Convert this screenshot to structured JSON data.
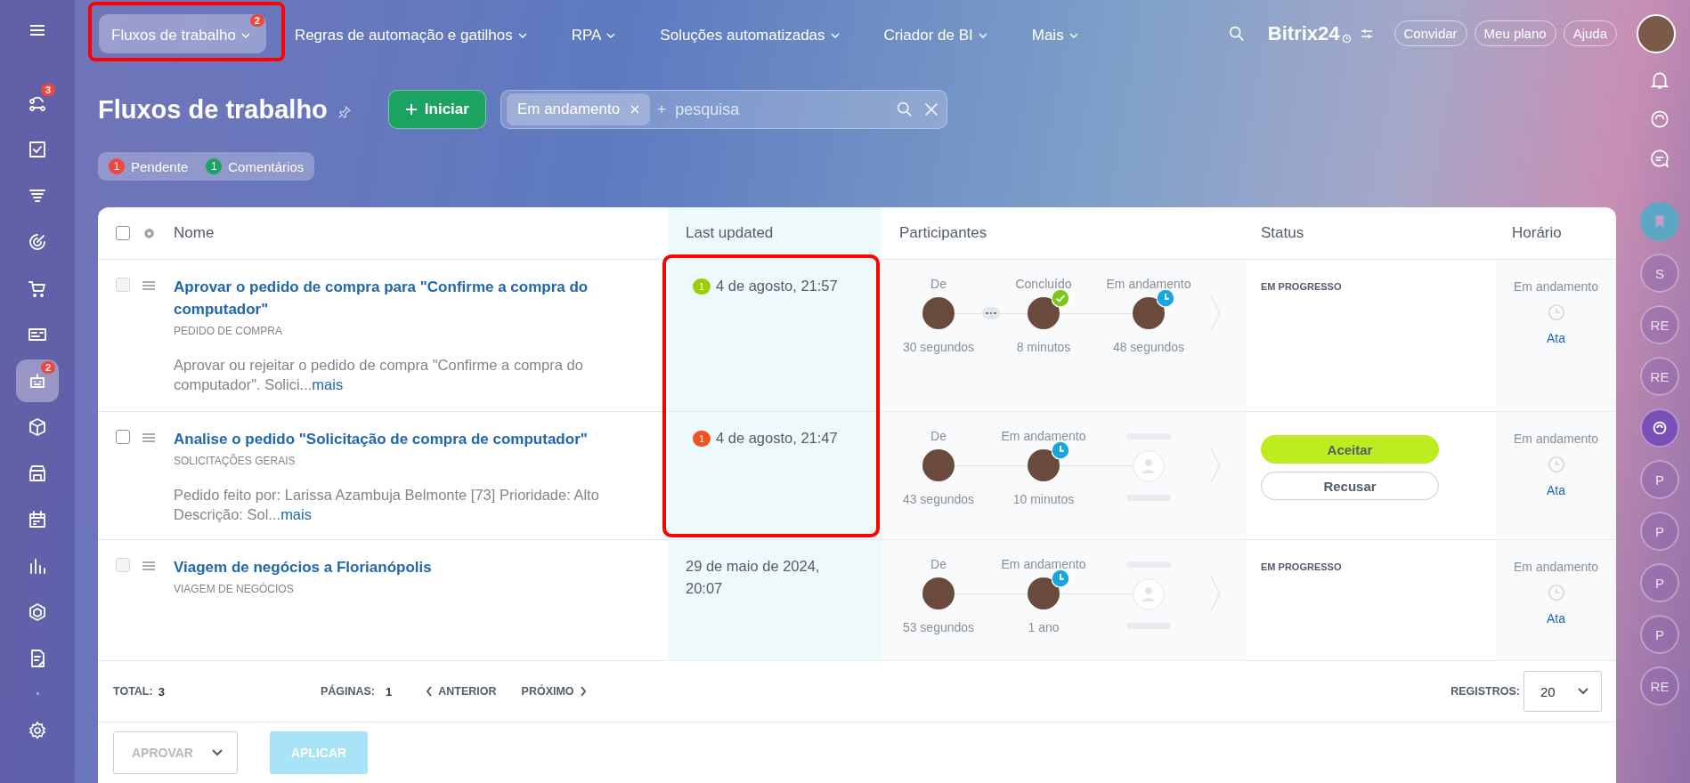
{
  "topbar": {
    "menu": [
      {
        "label": "Fluxos de trabalho",
        "selected": true,
        "badge": "2"
      },
      {
        "label": "Regras de automação e gatilhos",
        "selected": false
      },
      {
        "label": "RPA",
        "selected": false
      },
      {
        "label": "Soluções automatizadas",
        "selected": false
      },
      {
        "label": "Criador de BI",
        "selected": false
      },
      {
        "label": "Mais",
        "selected": false
      }
    ],
    "brand": "Bitrix24",
    "buttons": [
      "Convidar",
      "Meu plano",
      "Ajuda"
    ]
  },
  "sidebar": {
    "items": [
      {
        "selected": false,
        "badge": "3"
      },
      {
        "selected": false
      },
      {
        "selected": false
      },
      {
        "selected": false
      },
      {
        "selected": false
      },
      {
        "selected": false
      },
      {
        "selected": true,
        "badge": "2"
      },
      {
        "selected": false
      },
      {
        "selected": false
      },
      {
        "selected": false
      },
      {
        "selected": false
      },
      {
        "selected": false
      },
      {
        "selected": false
      }
    ]
  },
  "header": {
    "title": "Fluxos de trabalho",
    "start_button": "Iniciar",
    "search": {
      "chip": "Em andamento",
      "plus": "+",
      "placeholder": "pesquisa"
    },
    "counters": [
      {
        "count": "1",
        "label": "Pendente",
        "color": "#f2453d"
      },
      {
        "count": "1",
        "label": "Comentários",
        "color": "#1ca363"
      }
    ]
  },
  "table": {
    "select_all": {
      "checked": false
    },
    "columns": [
      "Nome",
      "Last updated",
      "Participantes",
      "Status",
      "Horário"
    ],
    "rows": [
      {
        "disabled": true,
        "title": "Aprovar o pedido de compra para \"Confirme a compra do computador\"",
        "category": "PEDIDO DE COMPRA",
        "description": "Aprovar ou rejeitar o pedido de compra \"Confirme a compra do computador\". Solici...",
        "more": "mais",
        "updated": {
          "badge": "1",
          "color": "#9dcf00",
          "text": "4 de agosto, 21:57"
        },
        "more_hidden": true,
        "stages": [
          {
            "kind": "person",
            "label": "De",
            "duration": "30 segundos",
            "done": false,
            "running": false
          },
          {
            "kind": "person",
            "label": "Concluído",
            "duration": "8 minutos",
            "done": true,
            "running": false
          },
          {
            "kind": "person",
            "label": "Em andamento",
            "duration": "48 segundos",
            "done": false,
            "running": true
          }
        ],
        "status": {
          "kind": "text",
          "text": "EM PROGRESSO"
        },
        "time": {
          "label": "Em andamento",
          "link": "Ata"
        }
      },
      {
        "disabled": false,
        "title": "Analise o pedido \"Solicitação de compra de computador\"",
        "category": "SOLICITAÇÕES GERAIS",
        "description": "Pedido feito por: Larissa Azambuja Belmonte [73] Prioridade: Alto Descrição: Sol...",
        "more": "mais",
        "updated": {
          "badge": "1",
          "color": "#f4511e",
          "text": "4 de agosto, 21:47"
        },
        "more_hidden": false,
        "stages": [
          {
            "kind": "person",
            "label": "De",
            "duration": "43 segundos",
            "done": false,
            "running": false
          },
          {
            "kind": "person",
            "label": "Em andamento",
            "duration": "10 minutos",
            "done": false,
            "running": true
          },
          {
            "kind": "empty"
          }
        ],
        "status": {
          "kind": "actions",
          "buttons": [
            "Aceitar",
            "Recusar"
          ]
        },
        "time": {
          "label": "Em andamento",
          "link": "Ata"
        }
      },
      {
        "disabled": true,
        "title": "Viagem de negócios a Florianópolis",
        "category": "VIAGEM DE NEGÓCIOS",
        "updated": {
          "text": "29 de maio de 2024, 20:07"
        },
        "more_hidden": false,
        "stages": [
          {
            "kind": "person",
            "label": "De",
            "duration": "53 segundos",
            "done": false,
            "running": false
          },
          {
            "kind": "person",
            "label": "Em andamento",
            "duration": "1 ano",
            "done": false,
            "running": true
          },
          {
            "kind": "empty"
          }
        ],
        "status": {
          "kind": "text",
          "text": "EM PROGRESSO"
        },
        "time": {
          "label": "Em andamento",
          "link": "Ata"
        }
      }
    ]
  },
  "footer": {
    "total_label": "TOTAL:",
    "total": "3",
    "pages_label": "PÁGINAS:",
    "page": "1",
    "prev": "ANTERIOR",
    "next": "PRÓXIMO",
    "records_label": "REGISTROS:",
    "records": "20"
  },
  "actions": {
    "select": {
      "label": "APROVAR",
      "disabled": true
    },
    "apply": {
      "label": "APLICAR",
      "disabled": true
    }
  },
  "right_rail": [
    {
      "kind": "bookmark"
    },
    {
      "kind": "letter",
      "text": "S"
    },
    {
      "kind": "letter",
      "text": "RE"
    },
    {
      "kind": "letter",
      "text": "RE"
    },
    {
      "kind": "icon"
    },
    {
      "kind": "letter",
      "text": "P"
    },
    {
      "kind": "letter",
      "text": "P"
    },
    {
      "kind": "letter",
      "text": "P"
    },
    {
      "kind": "letter",
      "text": "P"
    },
    {
      "kind": "letter",
      "text": "RE"
    }
  ]
}
